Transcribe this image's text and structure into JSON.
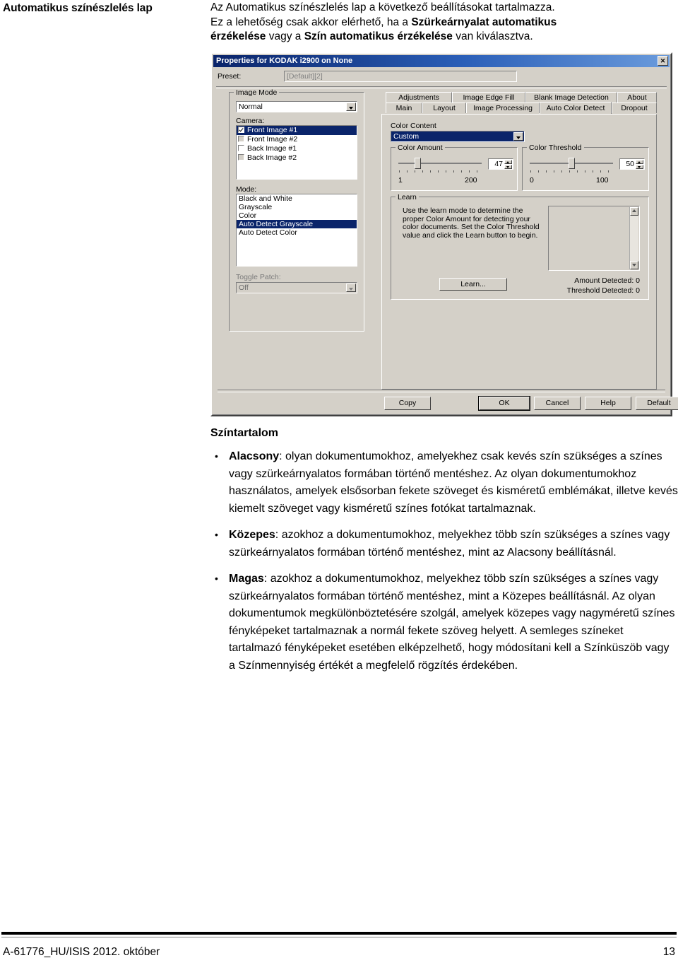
{
  "margin_heading": "Automatikus színészlelés lap",
  "intro": {
    "line1": "Az Automatikus színészlelés lap a következő beállításokat tartalmazza.",
    "line2_a": "Ez a lehetőség csak akkor elérhető, ha a ",
    "line2_b": "Szürkeárnyalat automatikus",
    "line3_a": "érzékelése",
    "line3_b": " vagy a ",
    "line3_c": "Szín automatikus érzékelése",
    "line3_d": " van kiválasztva."
  },
  "dialog": {
    "title": "Properties for KODAK i2900 on None",
    "close_label": "✕",
    "preset": {
      "label": "Preset:",
      "value": "[Default][2]"
    },
    "left_panel": {
      "image_mode_label": "Image Mode",
      "image_mode_value": "Normal",
      "camera_label": "Camera:",
      "camera_items": [
        {
          "label": "Front Image #1",
          "checked": true,
          "selected": true,
          "grayed": false
        },
        {
          "label": "Front Image #2",
          "checked": false,
          "selected": false,
          "grayed": true
        },
        {
          "label": "Back Image #1",
          "checked": false,
          "selected": false,
          "grayed": false
        },
        {
          "label": "Back Image #2",
          "checked": false,
          "selected": false,
          "grayed": true
        }
      ],
      "mode_label": "Mode:",
      "mode_items": [
        {
          "label": "Black and White",
          "selected": false
        },
        {
          "label": "Grayscale",
          "selected": false
        },
        {
          "label": "Color",
          "selected": false
        },
        {
          "label": "Auto Detect Grayscale",
          "selected": true
        },
        {
          "label": "Auto Detect Color",
          "selected": false
        }
      ],
      "toggle_patch_label": "Toggle Patch:",
      "toggle_patch_value": "Off"
    },
    "tabs_top": [
      "Adjustments",
      "Image Edge Fill",
      "Blank Image Detection",
      "About"
    ],
    "tabs_bottom": [
      "Main",
      "Layout",
      "Image Processing",
      "Auto Color Detect",
      "Dropout"
    ],
    "active_tab": "Auto Color Detect",
    "tab_page": {
      "color_content_label": "Color Content",
      "color_content_value": "Custom",
      "color_amount": {
        "label": "Color Amount",
        "value": "47",
        "min_label": "1",
        "max_label": "200",
        "thumb_pct": 23
      },
      "color_threshold": {
        "label": "Color Threshold",
        "value": "50",
        "min_label": "0",
        "max_label": "100",
        "thumb_pct": 50
      },
      "learn": {
        "group_label": "Learn",
        "description": "Use the learn mode to determine the proper Color Amount for detecting your color documents. Set the Color Threshold value and click the Learn button to begin.",
        "button_label": "Learn...",
        "amount_detected_label": "Amount Detected:",
        "amount_detected_value": "0",
        "threshold_detected_label": "Threshold Detected:",
        "threshold_detected_value": "0"
      }
    },
    "buttons": [
      {
        "label": "Copy",
        "default": false
      },
      {
        "label": "OK",
        "default": true
      },
      {
        "label": "Cancel",
        "default": false
      },
      {
        "label": "Help",
        "default": false
      },
      {
        "label": "Default",
        "default": false
      }
    ]
  },
  "body": {
    "section_title": "Színtartalom",
    "bullets": [
      {
        "term": "Alacsony",
        "text": ": olyan dokumentumokhoz, amelyekhez csak kevés szín szükséges a színes vagy szürkeárnyalatos formában történő mentéshez. Az olyan dokumentumokhoz használatos, amelyek elsősorban fekete szöveget és kisméretű emblémákat, illetve kevés kiemelt szöveget vagy kisméretű színes fotókat tartalmaznak."
      },
      {
        "term": "Közepes",
        "text": ": azokhoz a dokumentumokhoz, melyekhez több szín szükséges a színes vagy szürkeárnyalatos formában történő mentéshez, mint az Alacsony beállításnál."
      },
      {
        "term": "Magas",
        "text": ": azokhoz a dokumentumokhoz, melyekhez több szín szükséges a színes vagy szürkeárnyalatos formában történő mentéshez, mint a Közepes beállításnál. Az olyan dokumentumok megkülönböztetésére szolgál, amelyek közepes vagy nagyméretű színes fényképeket tartalmaznak a normál fekete szöveg helyett. A semleges színeket tartalmazó fényképeket esetében elképzelhető, hogy módosítani kell a Színküszöb vagy a Színmennyiség értékét a megfelelő rögzítés érdekében."
      }
    ]
  },
  "footer": {
    "left": "A-61776_HU/ISIS 2012. október",
    "right": "13"
  }
}
